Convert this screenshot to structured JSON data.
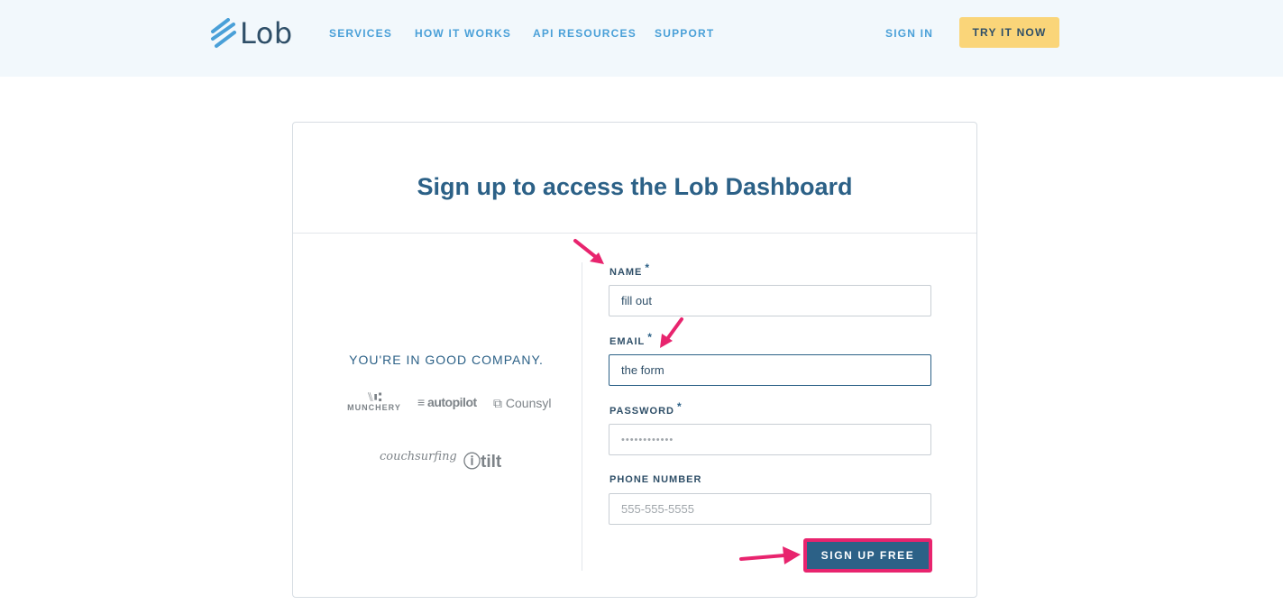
{
  "header": {
    "logo_text": "Lob",
    "nav": [
      "SERVICES",
      "HOW IT WORKS",
      "API RESOURCES",
      "SUPPORT"
    ],
    "sign_in": "SIGN IN",
    "cta": "TRY IT NOW"
  },
  "card": {
    "title": "Sign up to access the Lob Dashboard",
    "company_heading": "YOU'RE IN GOOD COMPANY.",
    "brands": {
      "munchery": "MUNCHERY",
      "autopilot": "≡ autopilot",
      "counsyl": "⧉ Counsyl",
      "couchsurfing": "couchsurfing",
      "tilt": "ⓘtilt"
    }
  },
  "form": {
    "name": {
      "label": "NAME",
      "required_mark": "*",
      "value": "fill out"
    },
    "email": {
      "label": "EMAIL",
      "required_mark": "*",
      "value": "the form"
    },
    "password": {
      "label": "PASSWORD",
      "required_mark": "*",
      "value": "••••••••••••"
    },
    "phone": {
      "label": "PHONE NUMBER",
      "placeholder": "555-555-5555"
    },
    "submit": "SIGN UP FREE"
  },
  "colors": {
    "header_bg": "#f2f8fc",
    "nav_link": "#4aa0d8",
    "cta_bg": "#fad579",
    "title": "#2c6187",
    "submit_bg": "#2c6187",
    "annotation": "#e8246e"
  }
}
